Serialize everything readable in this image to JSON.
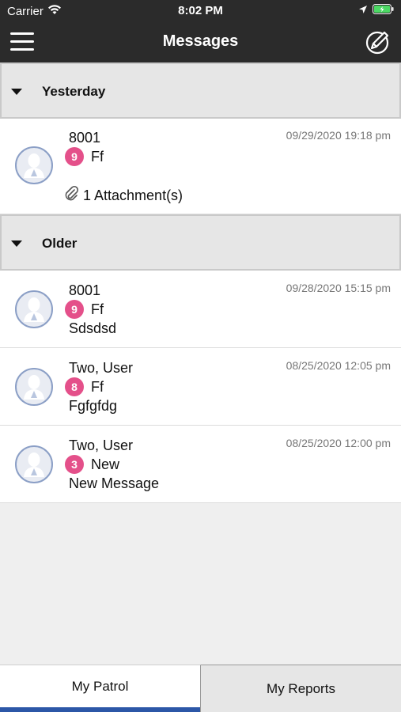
{
  "status_bar": {
    "carrier": "Carrier",
    "time": "8:02 PM"
  },
  "nav": {
    "title": "Messages",
    "menu_icon": "hamburger-menu-icon",
    "compose_icon": "compose-pencil-icon"
  },
  "sections": [
    {
      "label": "Yesterday",
      "messages": [
        {
          "sender": "8001",
          "badge": "9",
          "subject": "Ff",
          "preview": "",
          "timestamp": "09/29/2020 19:18 pm",
          "attachment": "1 Attachment(s)"
        }
      ]
    },
    {
      "label": "Older",
      "messages": [
        {
          "sender": "8001",
          "badge": "9",
          "subject": "Ff",
          "preview": "Sdsdsd",
          "timestamp": "09/28/2020 15:15 pm"
        },
        {
          "sender": "Two, User",
          "badge": "8",
          "subject": "Ff",
          "preview": "Fgfgfdg",
          "timestamp": "08/25/2020 12:05 pm"
        },
        {
          "sender": "Two, User",
          "badge": "3",
          "subject": "New",
          "preview": "New Message",
          "timestamp": "08/25/2020 12:00 pm"
        }
      ]
    }
  ],
  "tabs": {
    "patrol": "My Patrol",
    "reports": "My Reports"
  },
  "colors": {
    "header_bg": "#2b2b2b",
    "badge": "#e4508a",
    "active_tab_indicator": "#2c57a7",
    "battery": "#4cd964"
  }
}
